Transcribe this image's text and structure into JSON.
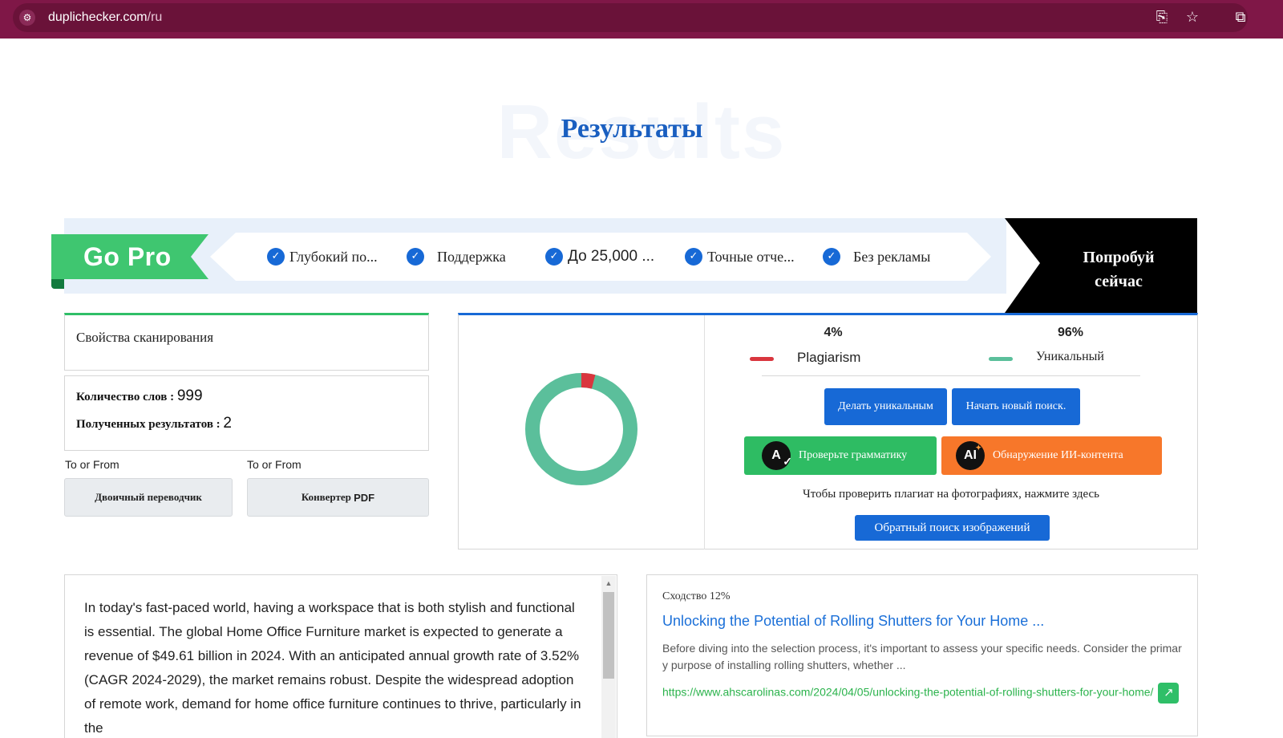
{
  "browser": {
    "url_domain": "duplichecker.com",
    "url_path": "/ru"
  },
  "header": {
    "bg_title": "Results",
    "title": "Результаты"
  },
  "gopro": {
    "tag": "Go Pro",
    "features": [
      "Глубокий по...",
      "Поддержка",
      "До 25,000 ...",
      "Точные отче...",
      "Без рекламы"
    ],
    "try_line1": "Попробуй",
    "try_line2": "сейчас"
  },
  "scan": {
    "title": "Свойства сканирования",
    "word_count_label": "Количество слов : ",
    "word_count": "999",
    "results_label": "Полученных результатов : ",
    "results": "2"
  },
  "tools": {
    "label1": "To or From",
    "label2": "To or From",
    "button1": "Двоичный переводчик",
    "button2_word": "Конвертер",
    "button2_suffix": "PDF"
  },
  "result": {
    "plagiarism_pct": "4%",
    "unique_pct": "96%",
    "plagiarism_label": "Plagiarism",
    "unique_label": "Уникальный",
    "plagiarism_value": 4,
    "unique_value": 96,
    "colors": {
      "plagiarism": "#d9363e",
      "unique": "#5bbf9b"
    },
    "make_unique_btn": "Делать уникальным",
    "new_search_btn": "Начать новый поиск.",
    "grammar_btn": "Проверьте грамматику",
    "ai_btn": "Обнаружение ИИ-контента",
    "photo_hint": "Чтобы проверить плагиат на фотографиях, нажмите здесь",
    "reverse_image_btn": "Обратный поиск изображений"
  },
  "text_panel": {
    "content": "In today's fast-paced world, having a workspace that is both stylish and functional is essential. The global Home Office Furniture market is expected to generate a revenue of $49.61 billion in 2024. With an anticipated annual growth rate of 3.52% (CAGR 2024-2029), the market remains robust. Despite the widespread adoption of remote work, demand for home office furniture continues to thrive, particularly in the"
  },
  "match": {
    "similarity": "Сходство 12%",
    "title": "Unlocking the Potential of Rolling Shutters for Your Home ...",
    "description": "Before diving into the selection process, it's important to assess your specific needs. Consider the primary purpose of installing rolling shutters, whether ...",
    "url": "https://www.ahscarolinas.com/2024/04/05/unlocking-the-potential-of-rolling-shutters-for-your-home/"
  }
}
